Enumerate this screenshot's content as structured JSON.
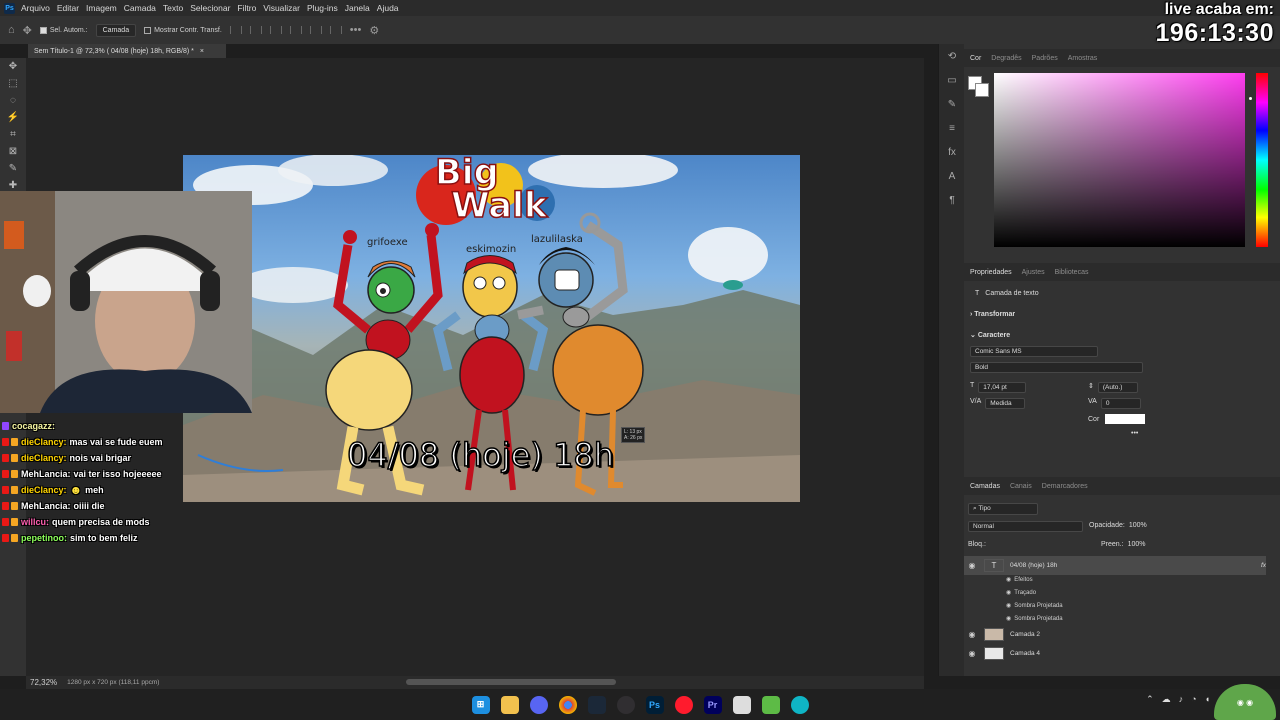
{
  "menubar": {
    "items": [
      "Arquivo",
      "Editar",
      "Imagem",
      "Camada",
      "Texto",
      "Selecionar",
      "Filtro",
      "Visualizar",
      "Plug-ins",
      "Janela",
      "Ajuda"
    ]
  },
  "options_bar": {
    "auto_select_label": "Sel. Autom.:",
    "auto_select_value": "Camada",
    "show_transform_label": "Mostrar Contr. Transf."
  },
  "live_overlay": {
    "title": "live acaba em:",
    "timer": "196:13:30"
  },
  "document": {
    "tab_title": "Sem Título-1 @ 72,3% ( 04/08 (hoje) 18h, RGB/8) *",
    "zoom": "72,32%",
    "size_info": "1280 px x 720 px (118,11 ppcm)"
  },
  "artwork": {
    "logo_line1": "Big",
    "logo_line2": "Walk",
    "characters": [
      "grifoexe",
      "eskimozin",
      "lazulilaska"
    ],
    "date_text": "04/08 (hoje) 18h",
    "cursor_tip_line1": "L: 13 px",
    "cursor_tip_line2": "A: 26 px"
  },
  "chat": [
    {
      "user": "cocagazz:",
      "message": "",
      "color": "#f5f5a0"
    },
    {
      "user": "dieClancy:",
      "message": "mas vai se fude euem",
      "color": "#ffd400"
    },
    {
      "user": "dieClancy:",
      "message": "nois vai brigar",
      "color": "#ffd400"
    },
    {
      "user": "MehLancia:",
      "message": "vai ter isso hojeeeee",
      "color": "#ffffff"
    },
    {
      "user": "dieClancy:",
      "message": "meh",
      "color": "#ffd400"
    },
    {
      "user": "MehLancia:",
      "message": "oiiii die",
      "color": "#ffffff"
    },
    {
      "user": "willcu:",
      "message": "quem precisa de mods",
      "color": "#ff5fb0"
    },
    {
      "user": "pepetinoo:",
      "message": "sim to bem feliz",
      "color": "#8cff5a"
    }
  ],
  "color_panel": {
    "tabs": [
      "Cor",
      "Degradês",
      "Padrões",
      "Amostras"
    ],
    "active_tab": "Cor",
    "selected_color": "#ff3df0"
  },
  "properties_panel": {
    "tabs": [
      "Propriedades",
      "Ajustes",
      "Bibliotecas"
    ],
    "layer_type": "Camada de texto",
    "transform_label": "Transformar",
    "character_label": "Caractere",
    "font_family": "Comic Sans MS",
    "font_style": "Bold",
    "font_size": "17,04 pt",
    "leading": "(Auto.)",
    "kerning": "Medida",
    "tracking": "0",
    "color_label": "Cor"
  },
  "layers_panel": {
    "tabs": [
      "Camadas",
      "Canais",
      "Demarcadores"
    ],
    "filter": "Tipo",
    "blend_mode": "Normal",
    "opacity_label": "Opacidade:",
    "opacity": "100%",
    "lock_label": "Bloq.:",
    "fill_label": "Preen.:",
    "fill": "100%",
    "layers": [
      {
        "name": "04/08 (hoje) 18h",
        "type": "text"
      },
      {
        "name": "Camada 2",
        "type": "image"
      },
      {
        "name": "Camada 4",
        "type": "image"
      }
    ],
    "effects_label": "Efeitos",
    "effects": [
      "Traçado",
      "Sombra Projetada",
      "Sombra Projetada"
    ]
  },
  "taskbar": {
    "apps": [
      "windows-start",
      "file-explorer",
      "discord",
      "chrome",
      "steam",
      "obs",
      "photoshop",
      "opera",
      "premiere",
      "capcut",
      "minecraft",
      "edge"
    ]
  }
}
